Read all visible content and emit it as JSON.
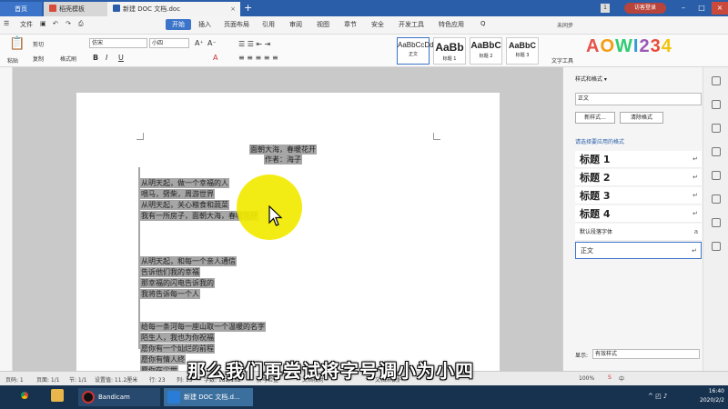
{
  "tabs": {
    "home": "首页",
    "templates": "稻壳模板",
    "doc": "新建 DOC 文档.doc",
    "add": "+",
    "window_num": "1",
    "login": "访客登录"
  },
  "menu": {
    "file": "文件",
    "start": "开始",
    "insert": "插入",
    "layout": "页面布局",
    "reference": "引用",
    "review": "审阅",
    "view": "视图",
    "section": "章节",
    "security": "安全",
    "devtools": "开发工具",
    "features": "特色应用",
    "search": "Q",
    "sync": "未同步"
  },
  "ribbon": {
    "cut": "剪切",
    "copy": "复制",
    "paste": "粘贴",
    "format_painter": "格式刷",
    "font": "仿宋",
    "size": "小四",
    "bold": "B",
    "italic": "I",
    "underline": "U",
    "styles": [
      {
        "preview": "AaBbCcDd",
        "label": "正文"
      },
      {
        "preview": "AaBb",
        "label": "标题 1"
      },
      {
        "preview": "AaBbC",
        "label": "标题 2"
      },
      {
        "preview": "AaBbC",
        "label": "标题 3"
      }
    ],
    "text_tool": "文字工具",
    "logo": "AOWI234"
  },
  "document": {
    "title": "面朝大海，春暖花开",
    "author": "作者：海子",
    "stanza1": [
      "从明天起，做一个幸福的人",
      "喂马，劈柴，周游世界",
      "从明天起，关心粮食和蔬菜",
      "我有一所房子，面朝大海，春暖花开"
    ],
    "stanza2": [
      "从明天起，和每一个亲人通信",
      "告诉他们我的幸福",
      "那幸福的闪电告诉我的",
      "我将告诉每一个人"
    ],
    "stanza3": [
      "给每一条河每一座山取一个温暖的名字",
      "陌生人，我也为你祝福",
      "愿你有一个灿烂的前程",
      "愿你有情人终",
      "愿你在尘世"
    ]
  },
  "style_panel": {
    "header": "样式和格式 ▾",
    "current": "正文",
    "new_style": "新样式...",
    "clear_format": "清除格式",
    "choose_label": "请选择要应用的格式",
    "items": [
      "标题 1",
      "标题 2",
      "标题 3",
      "标题 4"
    ],
    "default_font": "默认段落字体",
    "normal": "正文",
    "show_label": "显示:",
    "show_value": "有效样式"
  },
  "status": {
    "page_num": "页码: 1",
    "pages": "页面: 1/1",
    "section": "节: 1/1",
    "setting": "设置值: 11.2厘米",
    "row": "行: 23",
    "col": "列: 15",
    "words": "字数: 182/182",
    "spell": "拼写检查",
    "doc_check": "文档校对",
    "doc_protect": "文档未保护",
    "zoom": "100%"
  },
  "subtitle": "那么我们再尝试将字号调小为小四",
  "taskbar": {
    "bandicam": "Bandicam",
    "wps": "新建 DOC 文档.d...",
    "time": "16:40",
    "date": "2020/2/2"
  },
  "colors": {
    "tabbar": "#2a5ea8",
    "accent": "#3b74c9",
    "highlight": "#f2ea00",
    "selection": "#a6a6a6",
    "taskbar": "#17324f"
  }
}
